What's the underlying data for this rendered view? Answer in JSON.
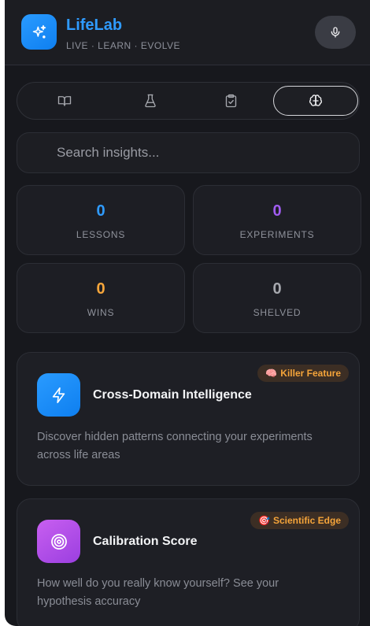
{
  "header": {
    "title": "LifeLab",
    "subtitle": "LIVE · LEARN · EVOLVE",
    "logo_icon": "sparkles-icon",
    "mic_icon": "microphone-icon"
  },
  "tabs": [
    {
      "icon": "book-icon",
      "active": false
    },
    {
      "icon": "flask-icon",
      "active": false
    },
    {
      "icon": "clipboard-check-icon",
      "active": false
    },
    {
      "icon": "brain-icon",
      "active": true
    }
  ],
  "search": {
    "placeholder": "Search insights..."
  },
  "stats": [
    {
      "value": "0",
      "label": "LESSONS",
      "color": "#2f9bff"
    },
    {
      "value": "0",
      "label": "EXPERIMENTS",
      "color": "#a05cf0"
    },
    {
      "value": "0",
      "label": "WINS",
      "color": "#f7a63b"
    },
    {
      "value": "0",
      "label": "SHELVED",
      "color": "#a6a8ae"
    }
  ],
  "cards": [
    {
      "title": "Cross-Domain Intelligence",
      "description": "Discover hidden patterns connecting your experiments across life areas",
      "badge": "Killer Feature",
      "badge_emoji": "🧠",
      "icon": "lightning-icon"
    },
    {
      "title": "Calibration Score",
      "description": "How well do you really know yourself? See your hypothesis accuracy",
      "badge": "Scientific Edge",
      "badge_emoji": "🎯",
      "icon": "target-icon"
    }
  ]
}
